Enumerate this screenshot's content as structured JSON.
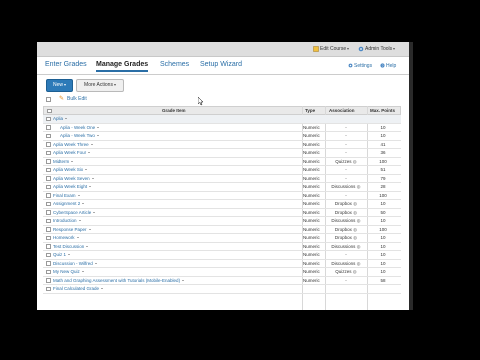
{
  "topbar": {
    "edit_course": "Edit Course",
    "admin_tools": "Admin Tools"
  },
  "tabs": [
    {
      "label": "Enter Grades",
      "active": false
    },
    {
      "label": "Manage Grades",
      "active": true
    },
    {
      "label": "Schemes",
      "active": false
    },
    {
      "label": "Setup Wizard",
      "active": false
    }
  ],
  "links": {
    "settings": "Settings",
    "help": "Help"
  },
  "actions": {
    "new_label": "New",
    "more_label": "More Actions"
  },
  "bulk": {
    "label": "Bulk Edit"
  },
  "table": {
    "headers": {
      "item": "Grade Item",
      "type": "Type",
      "association": "Association",
      "max": "Max. Points"
    },
    "rows": [
      {
        "name": "Aplia",
        "indent": 1,
        "category": true,
        "type": "",
        "association": "",
        "max": ""
      },
      {
        "name": "Aplia - Week One",
        "indent": 2,
        "category": false,
        "type": "Numeric",
        "association": "-",
        "max": "10"
      },
      {
        "name": "Aplia - Week Two",
        "indent": 2,
        "category": false,
        "type": "Numeric",
        "association": "-",
        "max": "10"
      },
      {
        "name": "Aplia Week Three",
        "indent": 1,
        "category": false,
        "type": "Numeric",
        "association": "-",
        "max": "41"
      },
      {
        "name": "Aplia Week Four",
        "indent": 1,
        "category": false,
        "type": "Numeric",
        "association": "-",
        "max": "36"
      },
      {
        "name": "Midterm",
        "indent": 1,
        "category": false,
        "type": "Numeric",
        "association": "Quizzes",
        "max": "100"
      },
      {
        "name": "Aplia Week Six",
        "indent": 1,
        "category": false,
        "type": "Numeric",
        "association": "-",
        "max": "51"
      },
      {
        "name": "Aplia Week Seven",
        "indent": 1,
        "category": false,
        "type": "Numeric",
        "association": "-",
        "max": "79"
      },
      {
        "name": "Aplia Week Eight",
        "indent": 1,
        "category": false,
        "type": "Numeric",
        "association": "Discussions",
        "max": "28"
      },
      {
        "name": "Final Exam",
        "indent": 1,
        "category": false,
        "type": "Numeric",
        "association": "-",
        "max": "100"
      },
      {
        "name": "Assignment 2",
        "indent": 1,
        "category": false,
        "type": "Numeric",
        "association": "Dropbox",
        "max": "10"
      },
      {
        "name": "CyberSpace Article",
        "indent": 1,
        "category": false,
        "type": "Numeric",
        "association": "Dropbox",
        "max": "50"
      },
      {
        "name": "Introduction",
        "indent": 1,
        "category": false,
        "type": "Numeric",
        "association": "Discussions",
        "max": "10"
      },
      {
        "name": "Response Paper",
        "indent": 1,
        "category": false,
        "type": "Numeric",
        "association": "Dropbox",
        "max": "100"
      },
      {
        "name": "Homework",
        "indent": 1,
        "category": false,
        "type": "Numeric",
        "association": "Dropbox",
        "max": "10"
      },
      {
        "name": "Test Discussion",
        "indent": 1,
        "category": false,
        "type": "Numeric",
        "association": "Discussions",
        "max": "10"
      },
      {
        "name": "Quiz 1",
        "indent": 1,
        "category": false,
        "type": "Numeric",
        "association": "-",
        "max": "10"
      },
      {
        "name": "Discussion - Wilfred",
        "indent": 1,
        "category": false,
        "type": "Numeric",
        "association": "Discussions",
        "max": "10"
      },
      {
        "name": "My New Quiz",
        "indent": 1,
        "category": false,
        "type": "Numeric",
        "association": "Quizzes",
        "max": "10"
      },
      {
        "name": "Math and Graphing Assessment with Tutorials (Mobile-Enabled)",
        "indent": 1,
        "category": false,
        "type": "Numeric",
        "association": "-",
        "max": "58"
      },
      {
        "name": "Final Calculated Grade",
        "indent": 1,
        "category": false,
        "type": "",
        "association": "",
        "max": ""
      }
    ]
  },
  "colors": {
    "link": "#2a6ea6",
    "primary_button": "#2d7ab8",
    "header_bg": "#e9e9e9"
  }
}
